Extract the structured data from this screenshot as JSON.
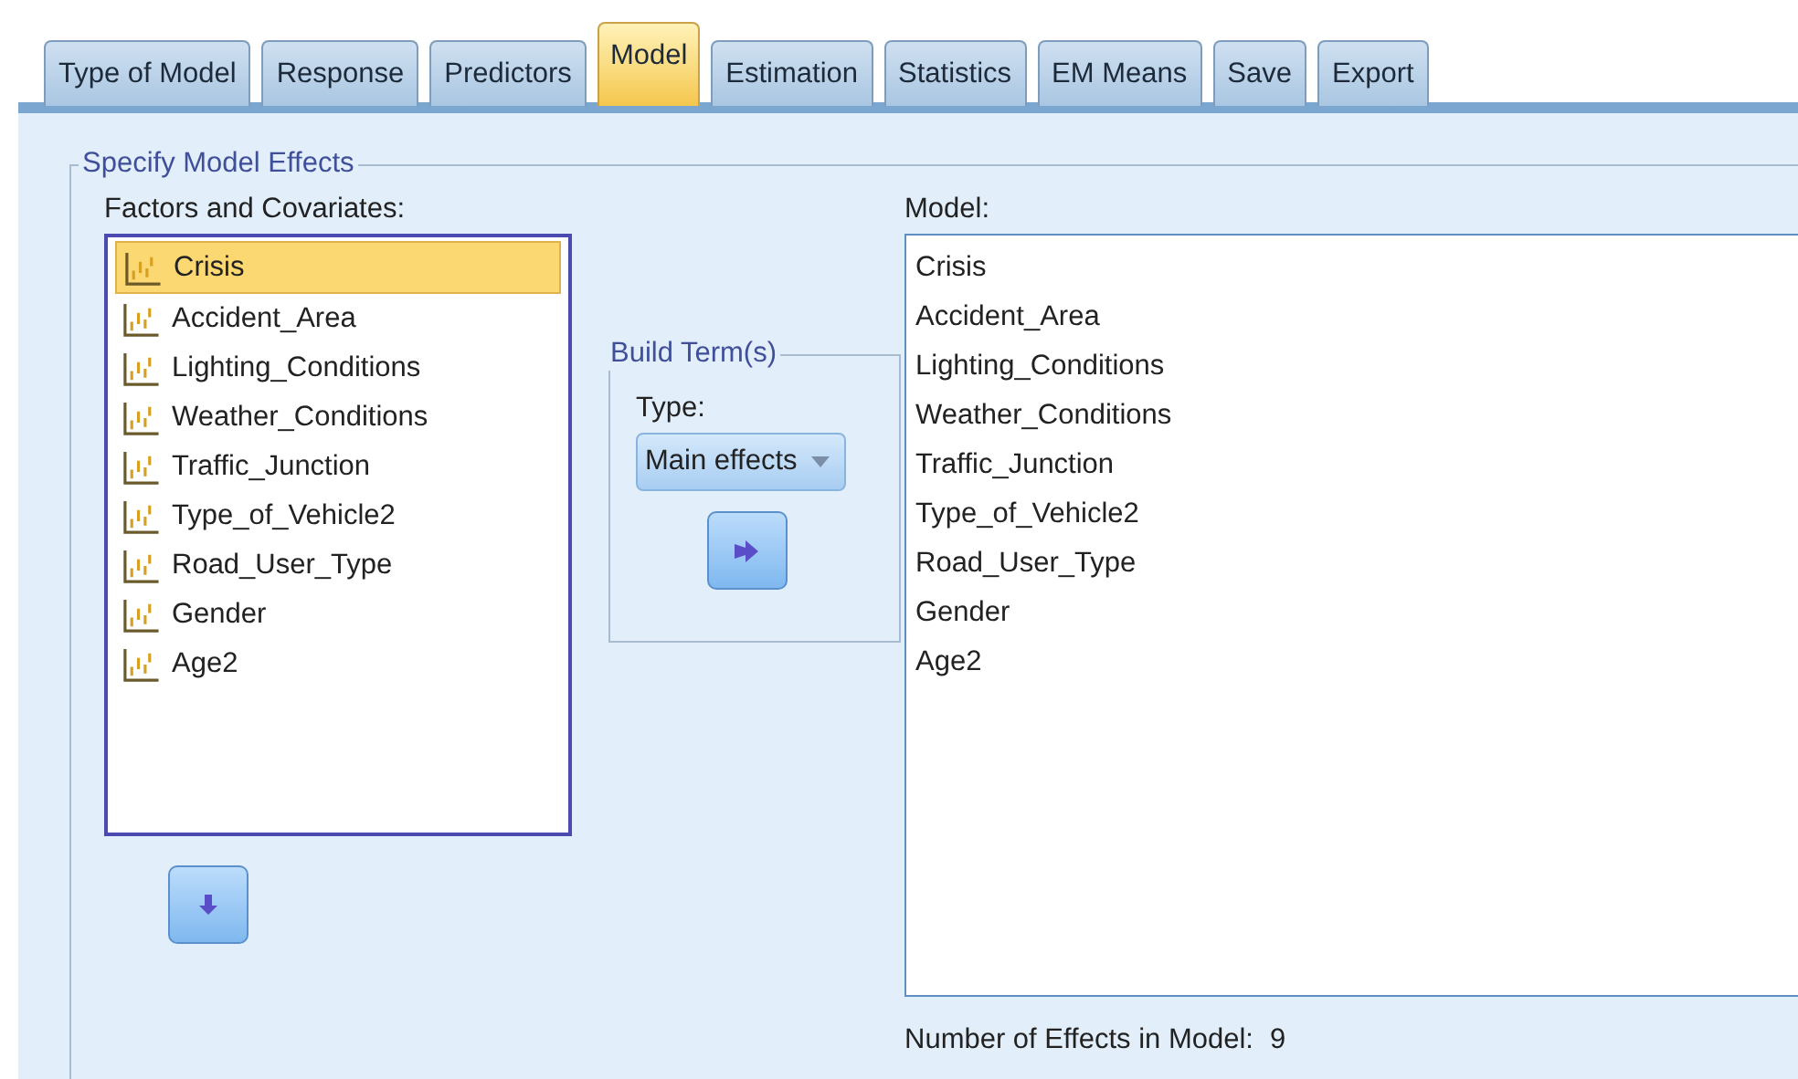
{
  "tabs": [
    {
      "label": "Type of Model",
      "selected": false
    },
    {
      "label": "Response",
      "selected": false
    },
    {
      "label": "Predictors",
      "selected": false
    },
    {
      "label": "Model",
      "selected": true
    },
    {
      "label": "Estimation",
      "selected": false
    },
    {
      "label": "Statistics",
      "selected": false
    },
    {
      "label": "EM Means",
      "selected": false
    },
    {
      "label": "Save",
      "selected": false
    },
    {
      "label": "Export",
      "selected": false
    }
  ],
  "group_title": "Specify Model Effects",
  "factors": {
    "label": "Factors and Covariates:",
    "items": [
      {
        "label": "Crisis",
        "selected": true
      },
      {
        "label": "Accident_Area",
        "selected": false
      },
      {
        "label": "Lighting_Conditions",
        "selected": false
      },
      {
        "label": "Weather_Conditions",
        "selected": false
      },
      {
        "label": "Traffic_Junction",
        "selected": false
      },
      {
        "label": "Type_of_Vehicle2",
        "selected": false
      },
      {
        "label": "Road_User_Type",
        "selected": false
      },
      {
        "label": "Gender",
        "selected": false
      },
      {
        "label": "Age2",
        "selected": false
      }
    ]
  },
  "build_terms": {
    "title": "Build Term(s)",
    "type_label": "Type:",
    "type_value": "Main effects"
  },
  "model": {
    "label": "Model:",
    "items": [
      "Crisis",
      "Accident_Area",
      "Lighting_Conditions",
      "Weather_Conditions",
      "Traffic_Junction",
      "Type_of_Vehicle2",
      "Road_User_Type",
      "Gender",
      "Age2"
    ]
  },
  "effects_count": {
    "label": "Number of Effects in Model:",
    "value": "9"
  }
}
